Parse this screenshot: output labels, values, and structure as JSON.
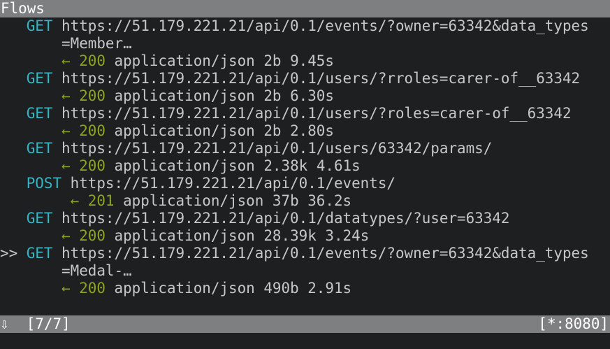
{
  "title": "Flows",
  "flows": [
    {
      "method": "GET",
      "url_line1": "https://51.179.221.21/api/0.1/events/?owner=63342&data_types",
      "url_line2": "=Member…",
      "arrow": "←",
      "status": "200",
      "content_type": "application/json",
      "size": "2b",
      "time": "9.45s"
    },
    {
      "method": "GET",
      "url_line1": "https://51.179.221.21/api/0.1/users/?rroles=carer-of__63342",
      "arrow": "←",
      "status": "200",
      "content_type": "application/json",
      "size": "2b",
      "time": "6.30s"
    },
    {
      "method": "GET",
      "url_line1": "https://51.179.221.21/api/0.1/users/?roles=carer-of__63342",
      "arrow": "←",
      "status": "200",
      "content_type": "application/json",
      "size": "2b",
      "time": "2.80s"
    },
    {
      "method": "GET",
      "url_line1": "https://51.179.221.21/api/0.1/users/63342/params/",
      "arrow": "←",
      "status": "200",
      "content_type": "application/json",
      "size": "2.38k",
      "time": "4.61s"
    },
    {
      "method": "POST",
      "url_line1": "https://51.179.221.21/api/0.1/events/",
      "arrow": "←",
      "status": "201",
      "content_type": "application/json",
      "size": "37b",
      "time": "36.2s"
    },
    {
      "method": "GET",
      "url_line1": "https://51.179.221.21/api/0.1/datatypes/?user=63342",
      "arrow": "←",
      "status": "200",
      "content_type": "application/json",
      "size": "28.39k",
      "time": "3.24s"
    },
    {
      "cursor": ">>",
      "method": "GET",
      "url_line1": "https://51.179.221.21/api/0.1/events/?owner=63342&data_types",
      "url_line2": "=Medal-…",
      "arrow": "←",
      "status": "200",
      "content_type": "application/json",
      "size": "490b",
      "time": "2.91s"
    }
  ],
  "statusbar": {
    "left_icon": "⇩",
    "position": "[7/7]",
    "listen": "[*:8080]"
  }
}
